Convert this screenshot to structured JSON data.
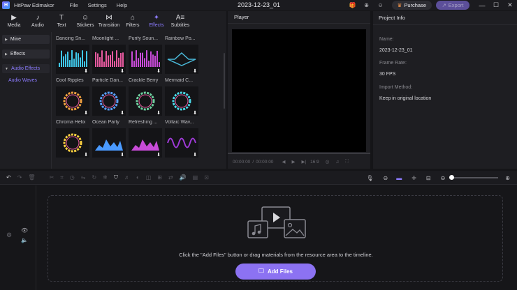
{
  "app": {
    "name": "HitPaw Edimakor",
    "logo_letter": "H",
    "menu": [
      "File",
      "Settings",
      "Help"
    ],
    "project_title": "2023-12-23_01",
    "purchase_label": "Purchase",
    "export_label": "Export"
  },
  "tabs": [
    {
      "label": "Media",
      "icon": "▶"
    },
    {
      "label": "Audio",
      "icon": "♪"
    },
    {
      "label": "Text",
      "icon": "T"
    },
    {
      "label": "Stickers",
      "icon": "☺"
    },
    {
      "label": "Transition",
      "icon": "⋈"
    },
    {
      "label": "Filters",
      "icon": "⌂"
    },
    {
      "label": "Effects",
      "icon": "✦"
    },
    {
      "label": "Subtitles",
      "icon": "A≡"
    }
  ],
  "sidebar": {
    "items": [
      "Mine",
      "Effects",
      "Audio Effects"
    ],
    "sub_item": "Audio Waves"
  },
  "effects": [
    {
      "label": "Dancing Sn...",
      "kind": "bars",
      "color": "#3fc6e8"
    },
    {
      "label": "Moonlight ...",
      "kind": "bars",
      "color": "#e85aa0"
    },
    {
      "label": "Purify Soun...",
      "kind": "bars",
      "color": "#c84bd8"
    },
    {
      "label": "Rainbow Po...",
      "kind": "wave",
      "color": "#4ab8d8"
    },
    {
      "label": "Cool Ripples",
      "kind": "ring",
      "color": "#f0a040"
    },
    {
      "label": "Particle Dan...",
      "kind": "ring",
      "color": "#5aa0ff"
    },
    {
      "label": "Crackle Berry",
      "kind": "ring",
      "color": "#6fd0a0"
    },
    {
      "label": "Mermaid C...",
      "kind": "ring",
      "color": "#4ad8e8"
    },
    {
      "label": "Chroma Helix",
      "kind": "ring",
      "color": "#ffd040"
    },
    {
      "label": "Ocean Party",
      "kind": "mountain",
      "color": "#4a9aff"
    },
    {
      "label": "Refreshing ...",
      "kind": "mountain",
      "color": "#c84bd8"
    },
    {
      "label": "Voltaic Wav...",
      "kind": "sine",
      "color": "#a03ad8"
    }
  ],
  "player": {
    "title": "Player",
    "current_time": "00:00:00",
    "total_time": "00:00:00",
    "ratio": "16:9"
  },
  "project_info": {
    "title": "Project Info",
    "fields": [
      {
        "label": "Name:",
        "value": "2023-12-23_01"
      },
      {
        "label": "Frame Rate:",
        "value": "30 FPS"
      },
      {
        "label": "Import Method:",
        "value": "Keep in original location"
      }
    ]
  },
  "timeline": {
    "drop_text": "Click the \"Add Files\" button or drag materials from the resource area to the timeline.",
    "add_files_label": "Add Files"
  },
  "colors": {
    "accent": "#8c7bff",
    "button": "#8c72f2"
  }
}
